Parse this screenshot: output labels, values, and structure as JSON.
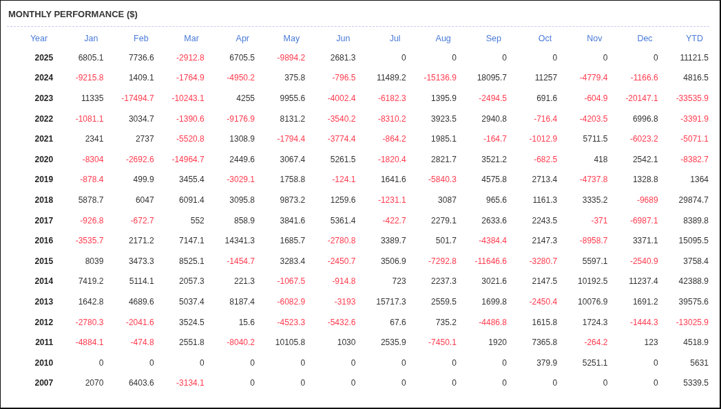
{
  "title": "MONTHLY PERFORMANCE ($)",
  "table": {
    "columns": [
      "Year",
      "Jan",
      "Feb",
      "Mar",
      "Apr",
      "May",
      "Jun",
      "Jul",
      "Aug",
      "Sep",
      "Oct",
      "Nov",
      "Dec",
      "YTD"
    ],
    "rows": [
      {
        "year": "2025",
        "values": [
          "6805.1",
          "7736.6",
          "-2912.8",
          "6705.5",
          "-9894.2",
          "2681.3",
          "0",
          "0",
          "0",
          "0",
          "0",
          "0",
          "11121.5"
        ],
        "negative": [
          false,
          false,
          true,
          false,
          true,
          false,
          false,
          false,
          false,
          false,
          false,
          false,
          false
        ]
      },
      {
        "year": "2024",
        "values": [
          "-9215.8",
          "1409.1",
          "-1764.9",
          "-4950.2",
          "375.8",
          "-796.5",
          "11489.2",
          "-15136.9",
          "18095.7",
          "11257",
          "-4779.4",
          "-1166.6",
          "4816.5"
        ],
        "negative": [
          true,
          false,
          true,
          true,
          false,
          true,
          false,
          true,
          false,
          false,
          true,
          true,
          false
        ]
      },
      {
        "year": "2023",
        "values": [
          "11335",
          "-17494.7",
          "-10243.1",
          "4255",
          "9955.6",
          "-4002.4",
          "-6182.3",
          "1395.9",
          "-2494.5",
          "691.6",
          "-604.9",
          "-20147.1",
          "-33535.9"
        ],
        "negative": [
          false,
          true,
          true,
          false,
          false,
          true,
          true,
          false,
          true,
          false,
          true,
          true,
          true
        ]
      },
      {
        "year": "2022",
        "values": [
          "-1081.1",
          "3034.7",
          "-1390.6",
          "-9176.9",
          "8131.2",
          "-3540.2",
          "-8310.2",
          "3923.5",
          "2940.8",
          "-716.4",
          "-4203.5",
          "6996.8",
          "-3391.9"
        ],
        "negative": [
          true,
          false,
          true,
          true,
          false,
          true,
          true,
          false,
          false,
          true,
          true,
          false,
          true
        ]
      },
      {
        "year": "2021",
        "values": [
          "2341",
          "2737",
          "-5520.8",
          "1308.9",
          "-1794.4",
          "-3774.4",
          "-864.2",
          "1985.1",
          "-164.7",
          "-1012.9",
          "5711.5",
          "-6023.2",
          "-5071.1"
        ],
        "negative": [
          false,
          false,
          true,
          false,
          true,
          true,
          true,
          false,
          true,
          true,
          false,
          true,
          true
        ]
      },
      {
        "year": "2020",
        "values": [
          "-8304",
          "-2692.6",
          "-14964.7",
          "2449.6",
          "3067.4",
          "5261.5",
          "-1820.4",
          "2821.7",
          "3521.2",
          "-682.5",
          "418",
          "2542.1",
          "-8382.7"
        ],
        "negative": [
          true,
          true,
          true,
          false,
          false,
          false,
          true,
          false,
          false,
          true,
          false,
          false,
          true
        ]
      },
      {
        "year": "2019",
        "values": [
          "-878.4",
          "499.9",
          "3455.4",
          "-3029.1",
          "1758.8",
          "-124.1",
          "1641.6",
          "-5840.3",
          "4575.8",
          "2713.4",
          "-4737.8",
          "1328.8",
          "1364"
        ],
        "negative": [
          true,
          false,
          false,
          true,
          false,
          true,
          false,
          true,
          false,
          false,
          true,
          false,
          false
        ]
      },
      {
        "year": "2018",
        "values": [
          "5878.7",
          "6047",
          "6091.4",
          "3095.8",
          "9873.2",
          "1259.6",
          "-1231.1",
          "3087",
          "965.6",
          "1161.3",
          "3335.2",
          "-9689",
          "29874.7"
        ],
        "negative": [
          false,
          false,
          false,
          false,
          false,
          false,
          true,
          false,
          false,
          false,
          false,
          true,
          false
        ]
      },
      {
        "year": "2017",
        "values": [
          "-926.8",
          "-672.7",
          "552",
          "858.9",
          "3841.6",
          "5361.4",
          "-422.7",
          "2279.1",
          "2633.6",
          "2243.5",
          "-371",
          "-6987.1",
          "8389.8"
        ],
        "negative": [
          true,
          true,
          false,
          false,
          false,
          false,
          true,
          false,
          false,
          false,
          true,
          true,
          false
        ]
      },
      {
        "year": "2016",
        "values": [
          "-3535.7",
          "2171.2",
          "7147.1",
          "14341.3",
          "1685.7",
          "-2780.8",
          "3389.7",
          "501.7",
          "-4384.4",
          "2147.3",
          "-8958.7",
          "3371.1",
          "15095.5"
        ],
        "negative": [
          true,
          false,
          false,
          false,
          false,
          true,
          false,
          false,
          true,
          false,
          true,
          false,
          false
        ]
      },
      {
        "year": "2015",
        "values": [
          "8039",
          "3473.3",
          "8525.1",
          "-1454.7",
          "3283.4",
          "-2450.7",
          "3506.9",
          "-7292.8",
          "-11646.6",
          "-3280.7",
          "5597.1",
          "-2540.9",
          "3758.4"
        ],
        "negative": [
          false,
          false,
          false,
          true,
          false,
          true,
          false,
          true,
          true,
          true,
          false,
          true,
          false
        ]
      },
      {
        "year": "2014",
        "values": [
          "7419.2",
          "5114.1",
          "2057.3",
          "221.3",
          "-1067.5",
          "-914.8",
          "723",
          "2237.3",
          "3021.6",
          "2147.5",
          "10192.5",
          "11237.4",
          "42388.9"
        ],
        "negative": [
          false,
          false,
          false,
          false,
          true,
          true,
          false,
          false,
          false,
          false,
          false,
          false,
          false
        ]
      },
      {
        "year": "2013",
        "values": [
          "1642.8",
          "4689.6",
          "5037.4",
          "8187.4",
          "-6082.9",
          "-3193",
          "15717.3",
          "2559.5",
          "1699.8",
          "-2450.4",
          "10076.9",
          "1691.2",
          "39575.6"
        ],
        "negative": [
          false,
          false,
          false,
          false,
          true,
          true,
          false,
          false,
          false,
          true,
          false,
          false,
          false
        ]
      },
      {
        "year": "2012",
        "values": [
          "-2780.3",
          "-2041.6",
          "3524.5",
          "15.6",
          "-4523.3",
          "-5432.6",
          "67.6",
          "735.2",
          "-4486.8",
          "1615.8",
          "1724.3",
          "-1444.3",
          "-13025.9"
        ],
        "negative": [
          true,
          true,
          false,
          false,
          true,
          true,
          false,
          false,
          true,
          false,
          false,
          true,
          true
        ]
      },
      {
        "year": "2011",
        "values": [
          "-4884.1",
          "-474.8",
          "2551.8",
          "-8040.2",
          "10105.8",
          "1030",
          "2535.9",
          "-7450.1",
          "1920",
          "7365.8",
          "-264.2",
          "123",
          "4518.9"
        ],
        "negative": [
          true,
          true,
          false,
          true,
          false,
          false,
          false,
          true,
          false,
          false,
          true,
          false,
          false
        ]
      },
      {
        "year": "2010",
        "values": [
          "0",
          "0",
          "0",
          "0",
          "0",
          "0",
          "0",
          "0",
          "0",
          "379.9",
          "5251.1",
          "0",
          "5631"
        ],
        "negative": [
          false,
          false,
          false,
          false,
          false,
          false,
          false,
          false,
          false,
          false,
          false,
          false,
          false
        ]
      },
      {
        "year": "2007",
        "values": [
          "2070",
          "6403.6",
          "-3134.1",
          "0",
          "0",
          "0",
          "0",
          "0",
          "0",
          "0",
          "0",
          "0",
          "5339.5"
        ],
        "negative": [
          false,
          false,
          true,
          false,
          false,
          false,
          false,
          false,
          false,
          false,
          false,
          false,
          false
        ]
      }
    ]
  }
}
